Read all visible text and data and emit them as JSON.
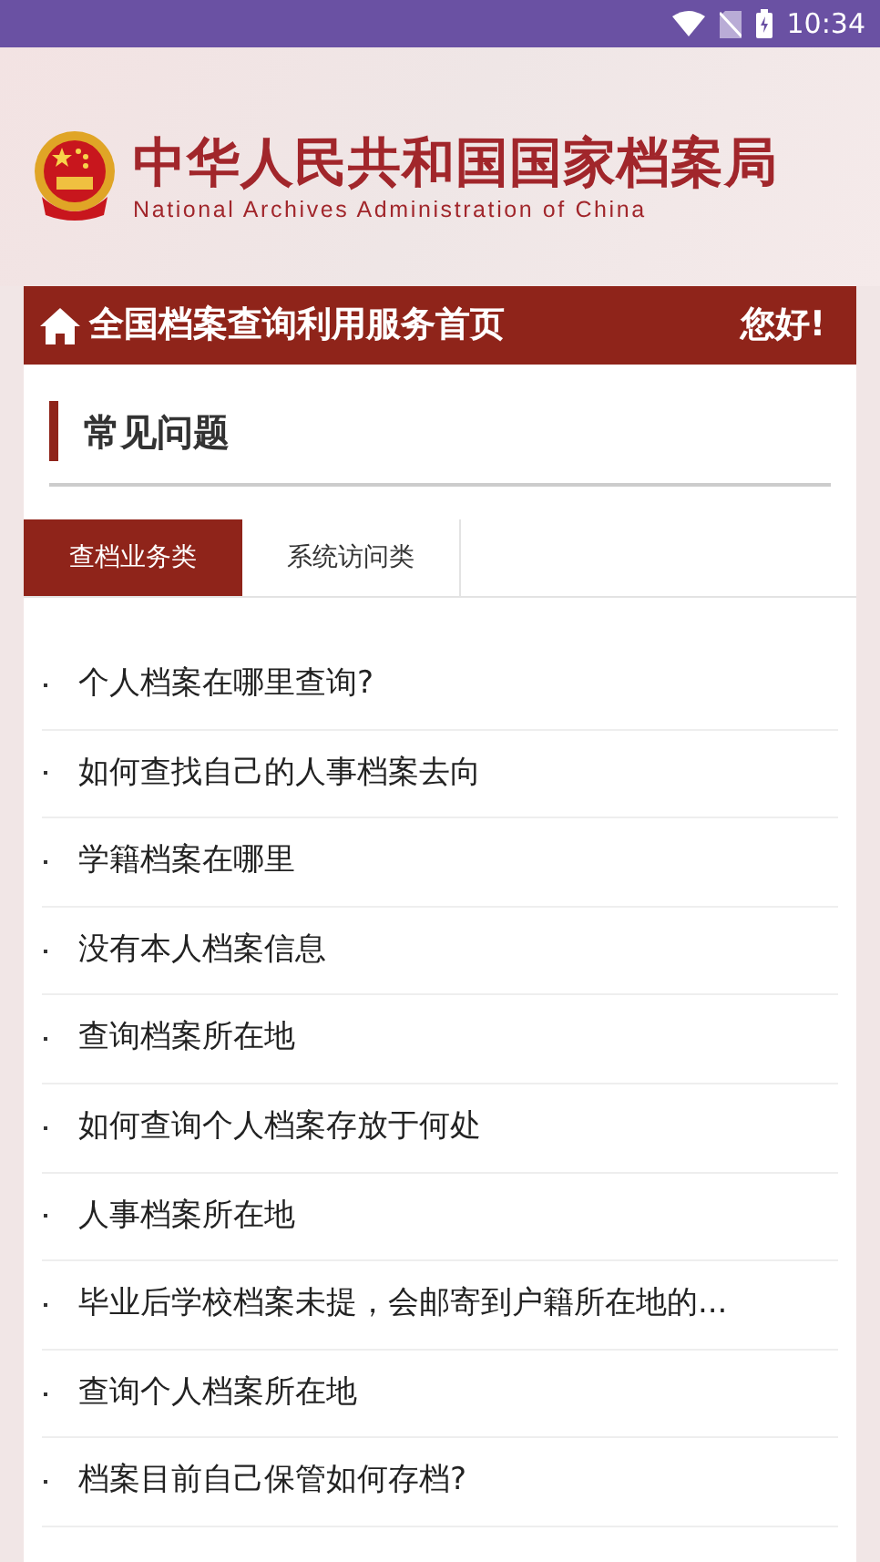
{
  "status_bar": {
    "time": "10:34"
  },
  "header": {
    "title": "中华人民共和国国家档案局",
    "subtitle": "National Archives Administration of China"
  },
  "nav_bar": {
    "title": "全国档案查询利用服务首页",
    "greeting": "您好!"
  },
  "section": {
    "title": "常见问题"
  },
  "tabs": [
    {
      "label": "查档业务类",
      "selected": true
    },
    {
      "label": "系统访问类",
      "selected": false
    }
  ],
  "questions": [
    "个人档案在哪里查询?",
    "如何查找自己的人事档案去向",
    "学籍档案在哪里",
    "没有本人档案信息",
    "查询档案所在地",
    "如何查询个人档案存放于何处",
    "人事档案所在地",
    "毕业后学校档案未提，会邮寄到户籍所在地的...",
    "查询个人档案所在地",
    "档案目前自己保管如何存档?"
  ]
}
